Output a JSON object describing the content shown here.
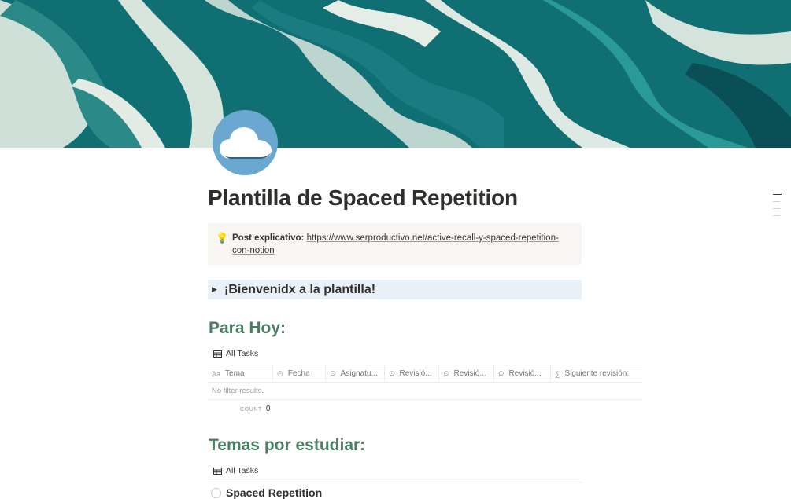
{
  "page": {
    "title": "Plantilla de Spaced Repetition",
    "icon": "cloud-icon",
    "icon_color": "#6aa8d2"
  },
  "callout": {
    "icon": "lightbulb-icon",
    "label": "Post explicativo:",
    "link": "https://www.serproductivo.net/active-recall-y-spaced-repetition-con-notion"
  },
  "toggle": {
    "label": "¡Bienvenidx a la plantilla!",
    "background": "#e7f1f7"
  },
  "section_today": {
    "heading": "Para Hoy:",
    "view_label": "All Tasks",
    "columns": [
      {
        "icon": "Aa",
        "label": "Tema"
      },
      {
        "icon": "◷",
        "label": "Fecha"
      },
      {
        "icon": "⊙",
        "label": "Asignatu..."
      },
      {
        "icon": "⊙",
        "label": "Revisió..."
      },
      {
        "icon": "⊙",
        "label": "Revisió..."
      },
      {
        "icon": "⊙",
        "label": "Revisió..."
      },
      {
        "icon": "∑",
        "label": "Siguiente revisión:"
      }
    ],
    "empty_text": "No filter results.",
    "count_label": "COUNT",
    "count_value": "0"
  },
  "section_study": {
    "heading": "Temas por estudiar:",
    "view_label": "All Tasks",
    "first_item": "Spaced Repetition"
  },
  "colors": {
    "heading_green": "#4b7f62",
    "callout_bg": "#f7f6f3"
  }
}
